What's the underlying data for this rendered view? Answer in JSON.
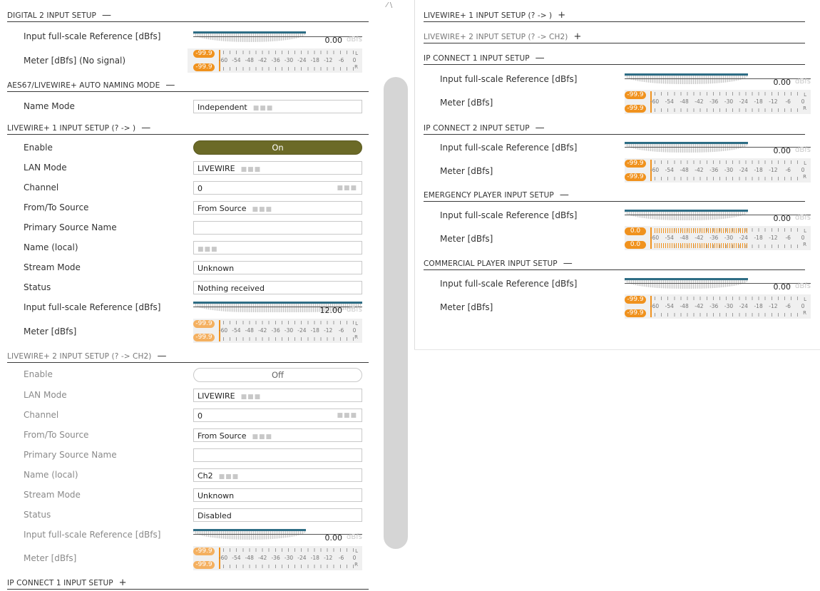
{
  "left": {
    "sections": [
      {
        "title": "DIGITAL 2 INPUT SETUP",
        "toggle": "—"
      },
      {
        "title": "AES67/LIVEWIRE+ AUTO NAMING MODE",
        "toggle": "—"
      },
      {
        "title": "LIVEWIRE+ 1 INPUT SETUP (? -> )",
        "toggle": "—"
      },
      {
        "title": "LIVEWIRE+ 2 INPUT SETUP (? -> CH2)",
        "toggle": "—"
      },
      {
        "title": "IP CONNECT 1 INPUT SETUP",
        "toggle": "+"
      }
    ],
    "digital2": {
      "ref_label": "Input full-scale Reference [dBfs]",
      "ref_value": "0.00",
      "ref_unit": "dBfs",
      "meter_label": "Meter [dBfs] (No signal)",
      "meter_l": "-99.9",
      "meter_r": "-99.9"
    },
    "naming": {
      "label": "Name Mode",
      "value": "Independent",
      "dots": "■■■"
    },
    "lw1": {
      "enable_label": "Enable",
      "enable_value": "On",
      "lan_label": "LAN Mode",
      "lan_value": "LIVEWIRE",
      "lan_dots": "■■■",
      "channel_label": "Channel",
      "channel_value": "0",
      "channel_dots": "■■■",
      "fromto_label": "From/To Source",
      "fromto_value": "From Source",
      "fromto_dots": "■■■",
      "primary_label": "Primary Source Name",
      "primary_value": "",
      "name_label": "Name (local)",
      "name_value": "",
      "name_dots": "■■■",
      "stream_label": "Stream Mode",
      "stream_value": "Unknown",
      "status_label": "Status",
      "status_value": "Nothing received",
      "ref_label": "Input full-scale Reference [dBfs]",
      "ref_value": "12.00",
      "ref_unit": "dBfs",
      "meter_label": "Meter [dBfs]",
      "meter_l": "-99.9",
      "meter_r": "-99.9"
    },
    "lw2": {
      "enable_label": "Enable",
      "enable_value": "Off",
      "lan_label": "LAN Mode",
      "lan_value": "LIVEWIRE",
      "lan_dots": "■■■",
      "channel_label": "Channel",
      "channel_value": "0",
      "channel_dots": "■■■",
      "fromto_label": "From/To Source",
      "fromto_value": "From Source",
      "fromto_dots": "■■■",
      "primary_label": "Primary Source Name",
      "primary_value": "",
      "name_label": "Name (local)",
      "name_value": "Ch2",
      "name_dots": "■■■",
      "stream_label": "Stream Mode",
      "stream_value": "Unknown",
      "status_label": "Status",
      "status_value": "Disabled",
      "ref_label": "Input full-scale Reference [dBfs]",
      "ref_value": "0.00",
      "ref_unit": "dBfs",
      "meter_label": "Meter [dBfs]",
      "meter_l": "-99.9",
      "meter_r": "-99.9"
    }
  },
  "right": {
    "sections": [
      {
        "title": "LIVEWIRE+ 1 INPUT SETUP (? -> )",
        "toggle": "+"
      },
      {
        "title": "LIVEWIRE+ 2 INPUT SETUP (? -> CH2)",
        "toggle": "+"
      },
      {
        "title": "IP CONNECT 1 INPUT SETUP",
        "toggle": "—"
      },
      {
        "title": "IP CONNECT 2 INPUT SETUP",
        "toggle": "—"
      },
      {
        "title": "EMERGENCY PLAYER INPUT SETUP",
        "toggle": "—"
      },
      {
        "title": "COMMERCIAL PLAYER INPUT SETUP",
        "toggle": "—"
      }
    ],
    "ipc1": {
      "ref_label": "Input full-scale Reference [dBfs]",
      "ref_value": "0.00",
      "ref_unit": "dBfs",
      "meter_label": "Meter [dBfs]",
      "meter_l": "-99.9",
      "meter_r": "-99.9"
    },
    "ipc2": {
      "ref_label": "Input full-scale Reference [dBfs]",
      "ref_value": "0.00",
      "ref_unit": "dBfs",
      "meter_label": "Meter [dBfs]",
      "meter_l": "-99.9",
      "meter_r": "-99.9"
    },
    "emergency": {
      "ref_label": "Input full-scale Reference [dBfs]",
      "ref_value": "0.00",
      "ref_unit": "dBfs",
      "meter_label": "Meter [dBfs]",
      "meter_l": "0.0",
      "meter_r": "0.0"
    },
    "commercial": {
      "ref_label": "Input full-scale Reference [dBfs]",
      "ref_value": "0.00",
      "ref_unit": "dBfs",
      "meter_label": "Meter [dBfs]",
      "meter_l": "-99.9",
      "meter_r": "-99.9"
    }
  },
  "meter_scale": [
    "-60",
    "-54",
    "-48",
    "-42",
    "-36",
    "-30",
    "-24",
    "-18",
    "-12",
    "-6",
    "0"
  ],
  "meter_channels": {
    "left": "L",
    "right": "R"
  },
  "colors": {
    "accent": "#6b6a27",
    "meter": "#f0921e",
    "ref_bar": "#2e6d85"
  }
}
